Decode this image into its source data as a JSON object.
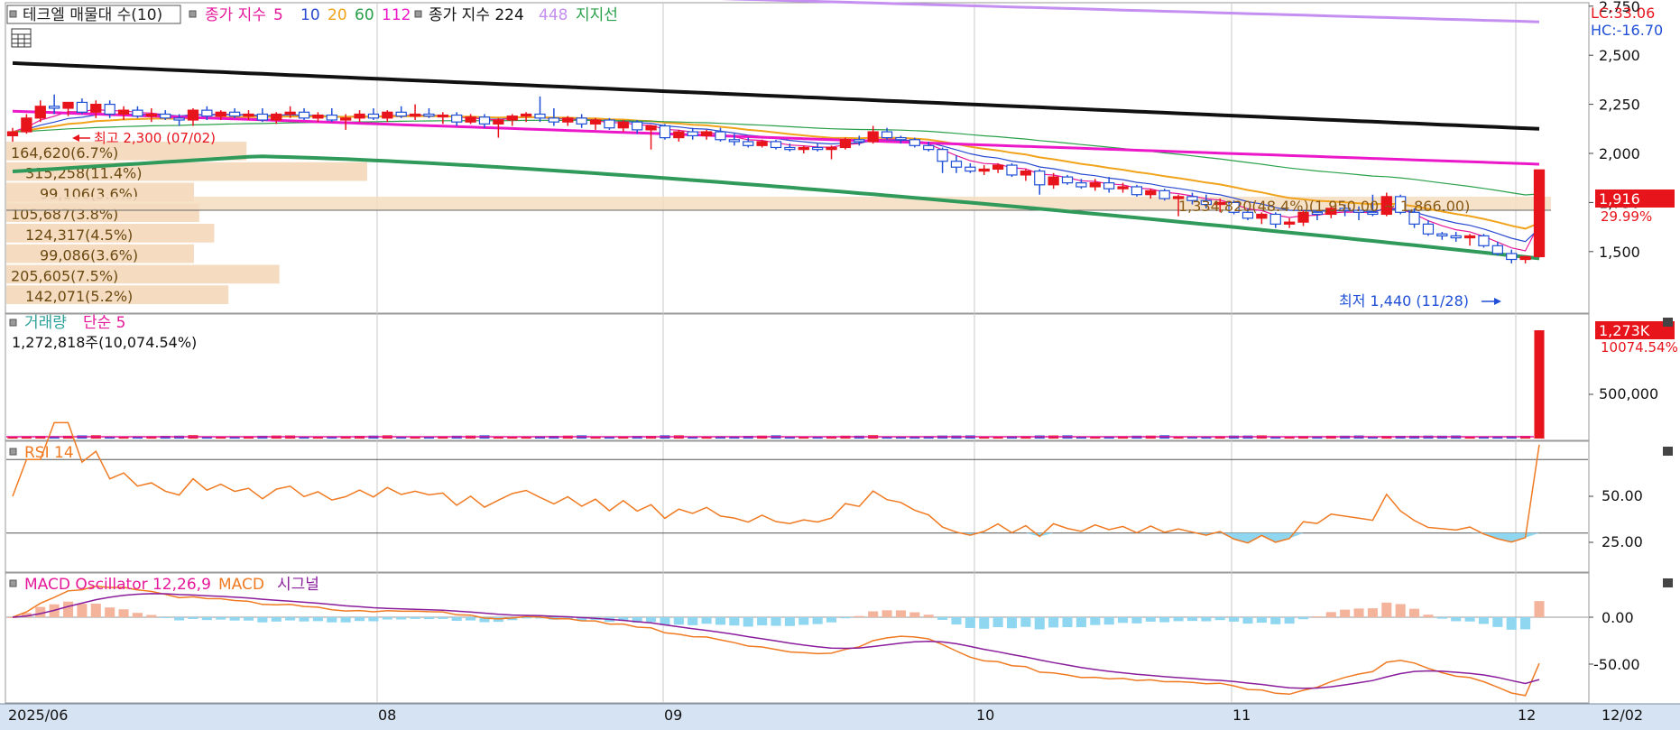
{
  "colors": {
    "up": "#e8141c",
    "down": "#1f4fd6",
    "ma5": "#e5179a",
    "ma10": "#2a4bd0",
    "ma20": "#f0a31b",
    "ma60": "#2aa04a",
    "ma112": "#ec17c9",
    "ma224": "#111111",
    "ma448": "#c48ff0",
    "support": "#2f9a5a",
    "rsi": "#f07a22",
    "rsi_fill": "#8fd6f0",
    "macd": "#f07a22",
    "signal": "#8a1d9c",
    "osc_pos": "#f4b49c",
    "osc_neg": "#8fd6f0",
    "vol_bar": "#f5dcc0",
    "price_tag": "#e8141c"
  },
  "price_panel": {
    "legend": {
      "vp": "테크엘 매물대 수(10)",
      "ma_label": "종가 지수",
      "ma5": "5",
      "ma10": "10",
      "ma20": "20",
      "ma60": "60",
      "ma112": "112",
      "ma224_label": "종가 지수 224",
      "ma448": "448",
      "support": "지지선"
    },
    "lc": "LC:33.06",
    "hc": "HC:-16.70",
    "current_price": "1,916",
    "current_change": "29.99%",
    "high_label": "최고 2,300 (07/02)",
    "low_label": "최저 1,440 (11/28)",
    "range_label": "1,334,820(48.4%)(1,950.00 ~ 1,866.00)",
    "y_ticks": [
      "2,750",
      "2,500",
      "2,250",
      "2,000",
      "1,750",
      "1,500"
    ]
  },
  "volume_profile": [
    {
      "label": "164,620(6.7%)",
      "value": 164620
    },
    {
      "label": "315,258(11.4%)",
      "value": 315258
    },
    {
      "label": "99,106(3.6%)",
      "value": 99106
    },
    {
      "label": "105,687(3.8%)",
      "value": 105687
    },
    {
      "label": "124,317(4.5%)",
      "value": 124317
    },
    {
      "label": "99,086(3.6%)",
      "value": 99086
    },
    {
      "label": "205,605(7.5%)",
      "value": 205605
    },
    {
      "label": "142,071(5.2%)",
      "value": 142071
    }
  ],
  "volume_panel": {
    "title": "거래량",
    "ma_label": "단순 5",
    "value_label": "1,272,818주(10,074.54%)",
    "tag_value": "1,273K",
    "tag_pct": "10074.54%",
    "y_ticks": [
      "500,000"
    ]
  },
  "rsi_panel": {
    "title": "RSI 14",
    "y_ticks": [
      "50.00",
      "25.00"
    ]
  },
  "macd_panel": {
    "title": "MACD Oscillator 12,26,9",
    "macd_label": "MACD",
    "signal_label": "시그널",
    "y_ticks": [
      "0.00",
      "-50.00"
    ]
  },
  "x_axis": {
    "labels": [
      "2025/06",
      "08",
      "09",
      "10",
      "11",
      "12",
      "12/02"
    ]
  },
  "chart_data": {
    "type": "candlestick",
    "x_range": [
      "2025/06",
      "12/02"
    ],
    "y_range": [
      1400,
      2900
    ],
    "high": {
      "value": 2300,
      "date": "07/02"
    },
    "low": {
      "value": 1440,
      "date": "11/28"
    },
    "last_close": 1916,
    "candles": [
      {
        "o": 2090,
        "h": 2130,
        "l": 2060,
        "c": 2110
      },
      {
        "o": 2110,
        "h": 2200,
        "l": 2100,
        "c": 2180
      },
      {
        "o": 2180,
        "h": 2270,
        "l": 2160,
        "c": 2240
      },
      {
        "o": 2240,
        "h": 2300,
        "l": 2200,
        "c": 2230
      },
      {
        "o": 2230,
        "h": 2260,
        "l": 2190,
        "c": 2260
      },
      {
        "o": 2260,
        "h": 2280,
        "l": 2200,
        "c": 2210
      },
      {
        "o": 2210,
        "h": 2270,
        "l": 2180,
        "c": 2250
      },
      {
        "o": 2250,
        "h": 2270,
        "l": 2180,
        "c": 2200
      },
      {
        "o": 2200,
        "h": 2240,
        "l": 2170,
        "c": 2220
      },
      {
        "o": 2220,
        "h": 2240,
        "l": 2180,
        "c": 2190
      },
      {
        "o": 2190,
        "h": 2230,
        "l": 2160,
        "c": 2200
      },
      {
        "o": 2200,
        "h": 2220,
        "l": 2170,
        "c": 2180
      },
      {
        "o": 2180,
        "h": 2200,
        "l": 2140,
        "c": 2170
      },
      {
        "o": 2170,
        "h": 2230,
        "l": 2140,
        "c": 2220
      },
      {
        "o": 2220,
        "h": 2240,
        "l": 2170,
        "c": 2190
      },
      {
        "o": 2190,
        "h": 2220,
        "l": 2170,
        "c": 2210
      },
      {
        "o": 2210,
        "h": 2230,
        "l": 2180,
        "c": 2190
      },
      {
        "o": 2190,
        "h": 2220,
        "l": 2170,
        "c": 2200
      },
      {
        "o": 2200,
        "h": 2230,
        "l": 2160,
        "c": 2170
      },
      {
        "o": 2170,
        "h": 2210,
        "l": 2150,
        "c": 2200
      },
      {
        "o": 2200,
        "h": 2240,
        "l": 2180,
        "c": 2210
      },
      {
        "o": 2210,
        "h": 2230,
        "l": 2170,
        "c": 2180
      },
      {
        "o": 2180,
        "h": 2210,
        "l": 2160,
        "c": 2195
      },
      {
        "o": 2195,
        "h": 2230,
        "l": 2160,
        "c": 2170
      },
      {
        "o": 2170,
        "h": 2200,
        "l": 2120,
        "c": 2180
      },
      {
        "o": 2180,
        "h": 2220,
        "l": 2160,
        "c": 2200
      },
      {
        "o": 2200,
        "h": 2230,
        "l": 2170,
        "c": 2180
      },
      {
        "o": 2180,
        "h": 2220,
        "l": 2160,
        "c": 2210
      },
      {
        "o": 2210,
        "h": 2240,
        "l": 2180,
        "c": 2190
      },
      {
        "o": 2190,
        "h": 2250,
        "l": 2170,
        "c": 2200
      },
      {
        "o": 2200,
        "h": 2230,
        "l": 2180,
        "c": 2190
      },
      {
        "o": 2190,
        "h": 2210,
        "l": 2150,
        "c": 2195
      },
      {
        "o": 2195,
        "h": 2210,
        "l": 2140,
        "c": 2160
      },
      {
        "o": 2160,
        "h": 2200,
        "l": 2150,
        "c": 2185
      },
      {
        "o": 2185,
        "h": 2200,
        "l": 2130,
        "c": 2150
      },
      {
        "o": 2150,
        "h": 2180,
        "l": 2080,
        "c": 2170
      },
      {
        "o": 2170,
        "h": 2200,
        "l": 2140,
        "c": 2190
      },
      {
        "o": 2190,
        "h": 2210,
        "l": 2160,
        "c": 2200
      },
      {
        "o": 2200,
        "h": 2290,
        "l": 2160,
        "c": 2180
      },
      {
        "o": 2180,
        "h": 2230,
        "l": 2140,
        "c": 2160
      },
      {
        "o": 2160,
        "h": 2190,
        "l": 2140,
        "c": 2180
      },
      {
        "o": 2180,
        "h": 2200,
        "l": 2130,
        "c": 2150
      },
      {
        "o": 2150,
        "h": 2180,
        "l": 2120,
        "c": 2170
      },
      {
        "o": 2170,
        "h": 2180,
        "l": 2120,
        "c": 2130
      },
      {
        "o": 2130,
        "h": 2170,
        "l": 2110,
        "c": 2160
      },
      {
        "o": 2160,
        "h": 2170,
        "l": 2100,
        "c": 2120
      },
      {
        "o": 2120,
        "h": 2140,
        "l": 2020,
        "c": 2140
      },
      {
        "o": 2140,
        "h": 2150,
        "l": 2070,
        "c": 2080
      },
      {
        "o": 2080,
        "h": 2120,
        "l": 2060,
        "c": 2110
      },
      {
        "o": 2110,
        "h": 2130,
        "l": 2070,
        "c": 2090
      },
      {
        "o": 2090,
        "h": 2120,
        "l": 2070,
        "c": 2110
      },
      {
        "o": 2110,
        "h": 2130,
        "l": 2060,
        "c": 2070
      },
      {
        "o": 2070,
        "h": 2100,
        "l": 2040,
        "c": 2060
      },
      {
        "o": 2060,
        "h": 2080,
        "l": 2030,
        "c": 2040
      },
      {
        "o": 2040,
        "h": 2070,
        "l": 2030,
        "c": 2060
      },
      {
        "o": 2060,
        "h": 2070,
        "l": 2020,
        "c": 2030
      },
      {
        "o": 2030,
        "h": 2050,
        "l": 2010,
        "c": 2020
      },
      {
        "o": 2020,
        "h": 2040,
        "l": 2000,
        "c": 2030
      },
      {
        "o": 2030,
        "h": 2050,
        "l": 2010,
        "c": 2020
      },
      {
        "o": 2020,
        "h": 2040,
        "l": 1970,
        "c": 2030
      },
      {
        "o": 2030,
        "h": 2080,
        "l": 2020,
        "c": 2070
      },
      {
        "o": 2070,
        "h": 2090,
        "l": 2040,
        "c": 2060
      },
      {
        "o": 2060,
        "h": 2140,
        "l": 2050,
        "c": 2110
      },
      {
        "o": 2110,
        "h": 2130,
        "l": 2070,
        "c": 2080
      },
      {
        "o": 2080,
        "h": 2090,
        "l": 2050,
        "c": 2070
      },
      {
        "o": 2070,
        "h": 2080,
        "l": 2030,
        "c": 2040
      },
      {
        "o": 2040,
        "h": 2060,
        "l": 2010,
        "c": 2020
      },
      {
        "o": 2020,
        "h": 2030,
        "l": 1900,
        "c": 1960
      },
      {
        "o": 1960,
        "h": 1990,
        "l": 1900,
        "c": 1930
      },
      {
        "o": 1930,
        "h": 1950,
        "l": 1900,
        "c": 1910
      },
      {
        "o": 1910,
        "h": 1940,
        "l": 1890,
        "c": 1920
      },
      {
        "o": 1920,
        "h": 1950,
        "l": 1900,
        "c": 1940
      },
      {
        "o": 1940,
        "h": 1950,
        "l": 1880,
        "c": 1890
      },
      {
        "o": 1890,
        "h": 1920,
        "l": 1860,
        "c": 1910
      },
      {
        "o": 1910,
        "h": 1920,
        "l": 1790,
        "c": 1840
      },
      {
        "o": 1840,
        "h": 1900,
        "l": 1820,
        "c": 1880
      },
      {
        "o": 1880,
        "h": 1890,
        "l": 1840,
        "c": 1850
      },
      {
        "o": 1850,
        "h": 1870,
        "l": 1820,
        "c": 1830
      },
      {
        "o": 1830,
        "h": 1870,
        "l": 1810,
        "c": 1850
      },
      {
        "o": 1850,
        "h": 1880,
        "l": 1800,
        "c": 1820
      },
      {
        "o": 1820,
        "h": 1850,
        "l": 1800,
        "c": 1830
      },
      {
        "o": 1830,
        "h": 1840,
        "l": 1780,
        "c": 1790
      },
      {
        "o": 1790,
        "h": 1820,
        "l": 1770,
        "c": 1810
      },
      {
        "o": 1810,
        "h": 1820,
        "l": 1760,
        "c": 1770
      },
      {
        "o": 1770,
        "h": 1790,
        "l": 1680,
        "c": 1780
      },
      {
        "o": 1780,
        "h": 1800,
        "l": 1740,
        "c": 1760
      },
      {
        "o": 1760,
        "h": 1790,
        "l": 1720,
        "c": 1740
      },
      {
        "o": 1740,
        "h": 1770,
        "l": 1700,
        "c": 1750
      },
      {
        "o": 1750,
        "h": 1760,
        "l": 1690,
        "c": 1700
      },
      {
        "o": 1700,
        "h": 1720,
        "l": 1660,
        "c": 1670
      },
      {
        "o": 1670,
        "h": 1700,
        "l": 1640,
        "c": 1690
      },
      {
        "o": 1690,
        "h": 1700,
        "l": 1620,
        "c": 1640
      },
      {
        "o": 1640,
        "h": 1670,
        "l": 1620,
        "c": 1650
      },
      {
        "o": 1650,
        "h": 1710,
        "l": 1630,
        "c": 1700
      },
      {
        "o": 1700,
        "h": 1710,
        "l": 1660,
        "c": 1690
      },
      {
        "o": 1690,
        "h": 1730,
        "l": 1670,
        "c": 1720
      },
      {
        "o": 1720,
        "h": 1740,
        "l": 1680,
        "c": 1710
      },
      {
        "o": 1710,
        "h": 1730,
        "l": 1660,
        "c": 1700
      },
      {
        "o": 1700,
        "h": 1790,
        "l": 1680,
        "c": 1690
      },
      {
        "o": 1690,
        "h": 1800,
        "l": 1680,
        "c": 1780
      },
      {
        "o": 1780,
        "h": 1790,
        "l": 1690,
        "c": 1700
      },
      {
        "o": 1700,
        "h": 1720,
        "l": 1620,
        "c": 1640
      },
      {
        "o": 1640,
        "h": 1660,
        "l": 1580,
        "c": 1590
      },
      {
        "o": 1590,
        "h": 1600,
        "l": 1560,
        "c": 1580
      },
      {
        "o": 1580,
        "h": 1600,
        "l": 1550,
        "c": 1570
      },
      {
        "o": 1570,
        "h": 1590,
        "l": 1530,
        "c": 1580
      },
      {
        "o": 1580,
        "h": 1590,
        "l": 1520,
        "c": 1530
      },
      {
        "o": 1530,
        "h": 1550,
        "l": 1480,
        "c": 1490
      },
      {
        "o": 1490,
        "h": 1510,
        "l": 1440,
        "c": 1460
      },
      {
        "o": 1460,
        "h": 1480,
        "l": 1440,
        "c": 1474
      },
      {
        "o": 1474,
        "h": 1916,
        "l": 1470,
        "c": 1916
      }
    ],
    "volume_max": 1272818,
    "rsi_scale": [
      0,
      100
    ],
    "macd_scale": [
      -80,
      30
    ]
  }
}
